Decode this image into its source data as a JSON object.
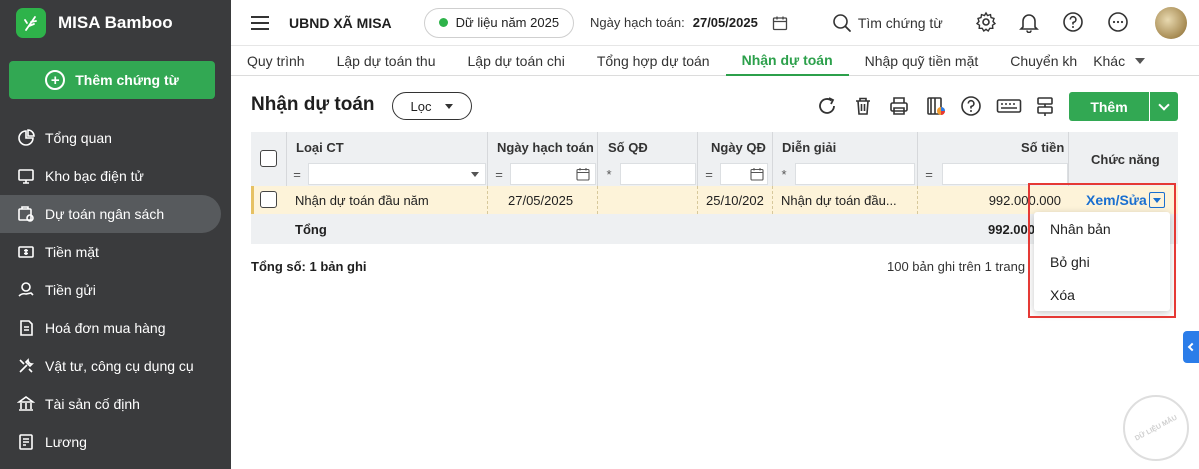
{
  "brand": {
    "name": "MISA Bamboo"
  },
  "sidebar": {
    "add_label": "Thêm chứng từ",
    "items": [
      {
        "label": "Tổng quan",
        "icon": "pie-chart-icon"
      },
      {
        "label": "Kho bạc điện tử",
        "icon": "monitor-icon"
      },
      {
        "label": "Dự toán ngân sách",
        "icon": "budget-icon",
        "active": true
      },
      {
        "label": "Tiền mặt",
        "icon": "cash-icon"
      },
      {
        "label": "Tiền gửi",
        "icon": "deposit-icon"
      },
      {
        "label": "Hoá đơn mua hàng",
        "icon": "invoice-icon"
      },
      {
        "label": "Vật tư, công cụ dụng cụ",
        "icon": "tools-icon"
      },
      {
        "label": "Tài sản cố định",
        "icon": "building-icon"
      },
      {
        "label": "Lương",
        "icon": "salary-icon"
      }
    ]
  },
  "header": {
    "org": "UBND XÃ MISA",
    "year_data": "Dữ liệu năm 2025",
    "posting_date_label": "Ngày hạch toán:",
    "posting_date": "27/05/2025",
    "search_label": "Tìm chứng từ"
  },
  "tabs": [
    {
      "label": "Quy trình"
    },
    {
      "label": "Lập dự toán thu"
    },
    {
      "label": "Lập dự toán chi"
    },
    {
      "label": "Tổng hợp dự toán"
    },
    {
      "label": "Nhận dự toán",
      "active": true
    },
    {
      "label": "Nhập quỹ tiền mặt"
    },
    {
      "label": "Chuyển kh"
    }
  ],
  "tab_more": "Khác",
  "page": {
    "title": "Nhận dự toán",
    "filter_label": "Lọc",
    "add_label": "Thêm"
  },
  "table": {
    "columns": {
      "type": "Loại CT",
      "date": "Ngày hạch toán",
      "decision_no": "Số QĐ",
      "decision_date": "Ngày QĐ",
      "description": "Diễn giải",
      "amount": "Số tiền",
      "actions": "Chức năng"
    },
    "filter_ops": {
      "eq": "=",
      "star": "*"
    },
    "rows": [
      {
        "type": "Nhận dự toán đầu năm",
        "date": "27/05/2025",
        "decision_no": "",
        "decision_date": "25/10/202",
        "description": "Nhận dự toán đầu...",
        "amount": "992.000.000",
        "action": "Xem/Sửa"
      }
    ],
    "total_label": "Tổng",
    "total_amount": "992.000"
  },
  "footer": {
    "count": "Tổng số: 1 bản ghi",
    "paging": "100 bản ghi trên 1 trang"
  },
  "menu": {
    "items": [
      "Nhân bản",
      "Bỏ ghi",
      "Xóa"
    ]
  },
  "watermark": "DỮ LIỆU MẪU",
  "colors": {
    "brand": "#32a853",
    "link": "#1a6fd0",
    "highlight": "#e53935",
    "sidebar": "#3a3b3d"
  }
}
